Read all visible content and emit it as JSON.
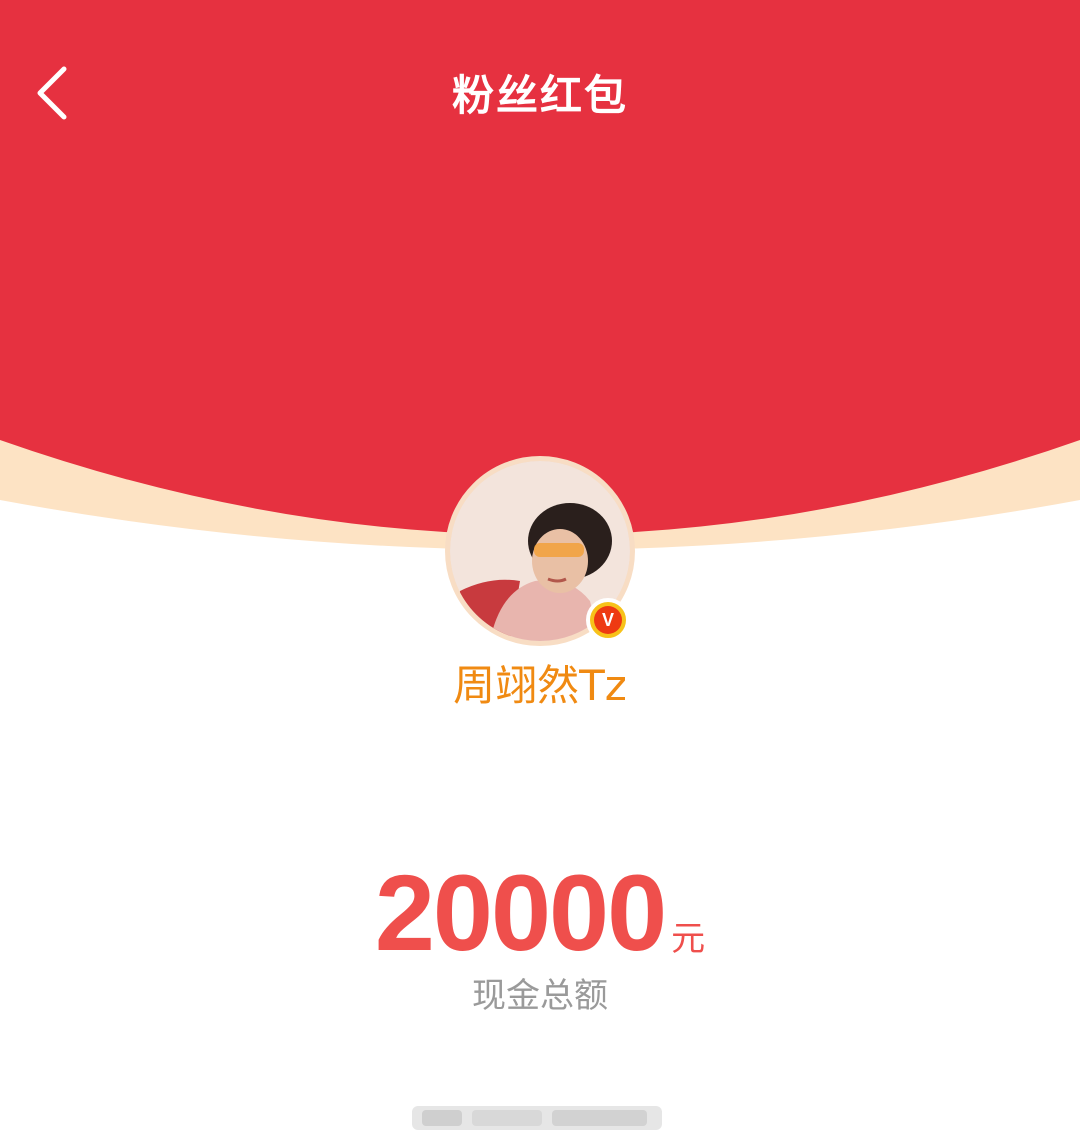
{
  "header": {
    "title": "粉丝红包",
    "back_icon": "chevron-left-icon"
  },
  "profile": {
    "username": "周翊然Tz",
    "verified_badge_text": "V"
  },
  "amount": {
    "value": "20000",
    "unit": "元",
    "label": "现金总额"
  },
  "colors": {
    "header_red": "#e63140",
    "curve_cream": "#fde3c4",
    "amount_red": "#ef4f4c",
    "username_orange": "#f08a12",
    "label_gray": "#9a9a9a",
    "badge_yellow": "#f7c21a"
  }
}
